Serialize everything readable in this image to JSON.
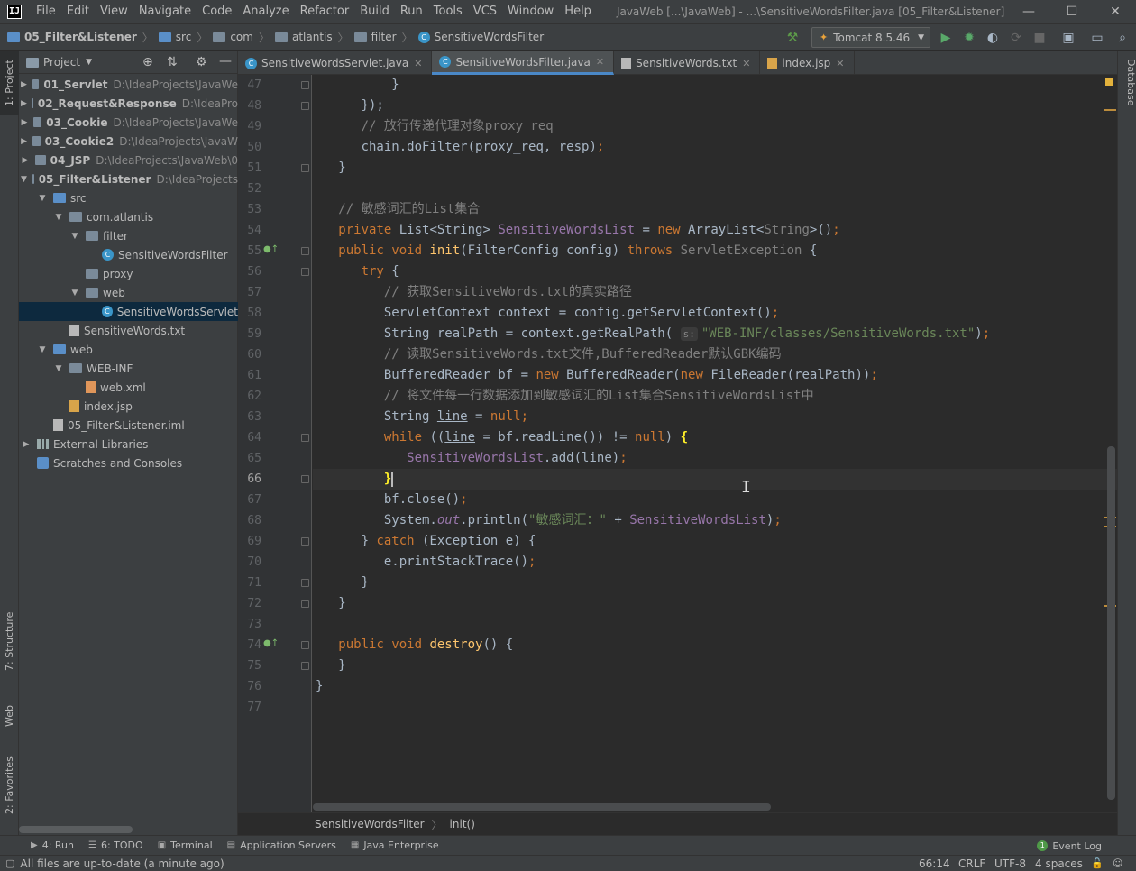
{
  "menu": {
    "items": [
      "File",
      "Edit",
      "View",
      "Navigate",
      "Code",
      "Analyze",
      "Refactor",
      "Build",
      "Run",
      "Tools",
      "VCS",
      "Window",
      "Help"
    ],
    "window_title": "JavaWeb [...\\JavaWeb] - ...\\SensitiveWordsFilter.java [05_Filter&Listener]"
  },
  "nav": {
    "crumbs": [
      "05_Filter&Listener",
      "src",
      "com",
      "atlantis",
      "filter",
      "SensitiveWordsFilter"
    ],
    "run_config": "Tomcat 8.5.46"
  },
  "left_strip": {
    "project": "1: Project",
    "structure": "7: Structure",
    "web": "Web",
    "favorites": "2: Favorites"
  },
  "right_strip": {
    "database": "Database"
  },
  "project": {
    "header": "Project",
    "tree": [
      {
        "name": "01_Servlet",
        "path": "D:\\IdeaProjects\\JavaWe"
      },
      {
        "name": "02_Request&Response",
        "path": "D:\\IdeaPro"
      },
      {
        "name": "03_Cookie",
        "path": "D:\\IdeaProjects\\JavaWe"
      },
      {
        "name": "03_Cookie2",
        "path": "D:\\IdeaProjects\\JavaW"
      },
      {
        "name": "04_JSP",
        "path": "D:\\IdeaProjects\\JavaWeb\\0"
      },
      {
        "name": "05_Filter&Listener",
        "path": "D:\\IdeaProjects"
      },
      {
        "name": "src"
      },
      {
        "name": "com.atlantis"
      },
      {
        "name": "filter"
      },
      {
        "name": "SensitiveWordsFilter"
      },
      {
        "name": "proxy"
      },
      {
        "name": "web"
      },
      {
        "name": "SensitiveWordsServlet"
      },
      {
        "name": "SensitiveWords.txt"
      },
      {
        "name": "web"
      },
      {
        "name": "WEB-INF"
      },
      {
        "name": "web.xml"
      },
      {
        "name": "index.jsp"
      },
      {
        "name": "05_Filter&Listener.iml"
      },
      {
        "name": "External Libraries"
      },
      {
        "name": "Scratches and Consoles"
      }
    ]
  },
  "tabs": [
    "SensitiveWordsServlet.java",
    "SensitiveWordsFilter.java",
    "SensitiveWords.txt",
    "index.jsp"
  ],
  "editor": {
    "line_numbers": [
      "47",
      "48",
      "49",
      "50",
      "51",
      "52",
      "53",
      "54",
      "55",
      "56",
      "57",
      "58",
      "59",
      "60",
      "61",
      "62",
      "63",
      "64",
      "65",
      "66",
      "67",
      "68",
      "69",
      "70",
      "71",
      "72",
      "73",
      "74",
      "75",
      "76",
      "77"
    ],
    "code": {
      "l47": "}",
      "l48": "});",
      "l49": "// 放行传递代理对象proxy_req",
      "l50a": "chain.doFilter(proxy_req, resp)",
      "l50b": ";",
      "l51": "}",
      "l53": "// 敏感词汇的List集合",
      "l54a": "private ",
      "l54b": "List<String> ",
      "l54c": "SensitiveWordsList",
      "l54d": " = ",
      "l54e": "new ",
      "l54f": "ArrayList<",
      "l54g": "String",
      "l54h": ">()",
      "l54i": ";",
      "l55a": "public void ",
      "l55b": "init",
      "l55c": "(FilterConfig config) ",
      "l55d": "throws ",
      "l55e": "ServletException",
      "l55f": " {",
      "l56a": "try ",
      "l56b": "{",
      "l57": "// 获取SensitiveWords.txt的真实路径",
      "l58a": "ServletContext context = config.getServletContext()",
      "l58b": ";",
      "l59a": "String realPath = context.getRealPath( ",
      "l59hint": "s:",
      "l59b": "\"WEB-INF/classes/SensitiveWords.txt\"",
      "l59c": ")",
      "l59d": ";",
      "l60": "// 读取SensitiveWords.txt文件,BufferedReader默认GBK编码",
      "l61a": "BufferedReader bf = ",
      "l61b": "new ",
      "l61c": "BufferedReader(",
      "l61d": "new ",
      "l61e": "FileReader(realPath))",
      "l61f": ";",
      "l62": "// 将文件每一行数据添加到敏感词汇的List集合SensitiveWordsList中",
      "l63a": "String ",
      "l63b": "line",
      "l63c": " = ",
      "l63d": "null;",
      "l64a": "while ",
      "l64b": "((",
      "l64c": "line",
      "l64d": " = bf.readLine()) != ",
      "l64e": "null",
      "l64f": ") ",
      "l64g": "{",
      "l65a": "SensitiveWordsList",
      "l65b": ".add(",
      "l65c": "line",
      "l65d": ")",
      "l65e": ";",
      "l66": "}",
      "l67a": "bf.close()",
      "l67b": ";",
      "l68a": "System.",
      "l68b": "out",
      "l68c": ".println(",
      "l68d": "\"敏感词汇：\"",
      "l68e": " + ",
      "l68f": "SensitiveWordsList",
      "l68g": ")",
      "l68h": ";",
      "l69a": "} ",
      "l69b": "catch ",
      "l69c": "(Exception e) {",
      "l70a": "e.printStackTrace()",
      "l70b": ";",
      "l71": "}",
      "l72": "}",
      "l74a": "public void ",
      "l74b": "destroy",
      "l74c": "() {",
      "l75": "}",
      "l76": "}"
    }
  },
  "breadcrumb": {
    "class": "SensitiveWordsFilter",
    "method": "init()"
  },
  "bottom_tools": {
    "run": "4: Run",
    "todo": "6: TODO",
    "terminal": "Terminal",
    "app_servers": "Application Servers",
    "java_enterprise": "Java Enterprise",
    "event_log": "Event Log"
  },
  "status": {
    "message": "All files are up-to-date (a minute ago)",
    "position": "66:14",
    "line_sep": "CRLF",
    "encoding": "UTF-8",
    "indent": "4 spaces"
  },
  "colors": {
    "keyword": "#cc7832",
    "comment": "#808080",
    "string": "#6a8759",
    "method": "#ffc66d",
    "field": "#9876aa",
    "text": "#a9b7c6"
  }
}
